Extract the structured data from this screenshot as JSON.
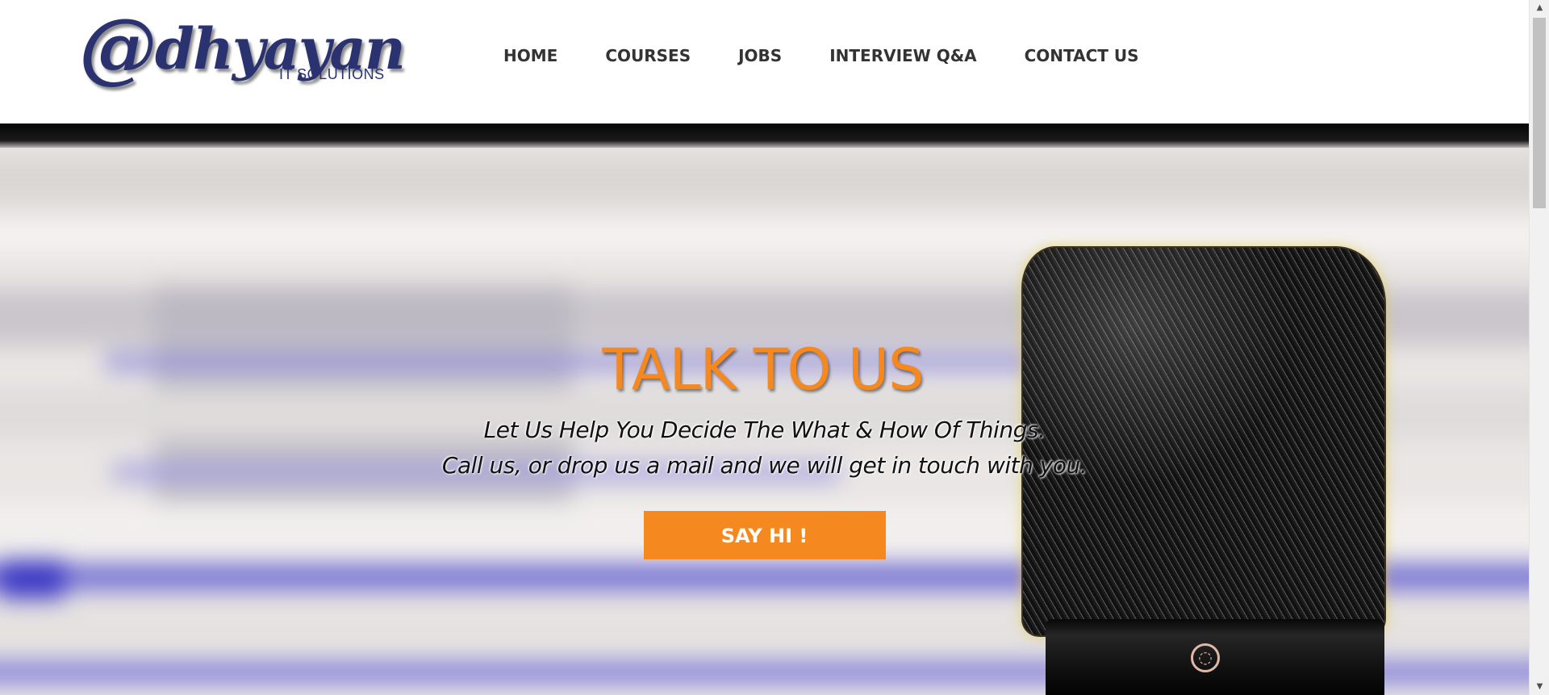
{
  "brand": {
    "logo_main": "dhyayan",
    "logo_at": "@",
    "logo_sub": "IT SOLUTIONS",
    "color_primary": "#2a3370"
  },
  "nav": {
    "items": [
      {
        "label": "HOME"
      },
      {
        "label": "COURSES"
      },
      {
        "label": "JOBS"
      },
      {
        "label": "INTERVIEW Q&A"
      },
      {
        "label": "CONTACT US"
      }
    ]
  },
  "hero": {
    "title": "TALK TO US",
    "line1": "Let Us Help You Decide The What & How Of Things.",
    "line2": "Call us, or drop us a mail and we will get in touch with you.",
    "cta_label": "SAY HI !",
    "accent_color": "#f5891f",
    "background_image": "microphone-image"
  },
  "scrollbar": {
    "up_icon": "scroll-up-arrow-icon",
    "down_icon": "scroll-down-arrow-icon"
  }
}
